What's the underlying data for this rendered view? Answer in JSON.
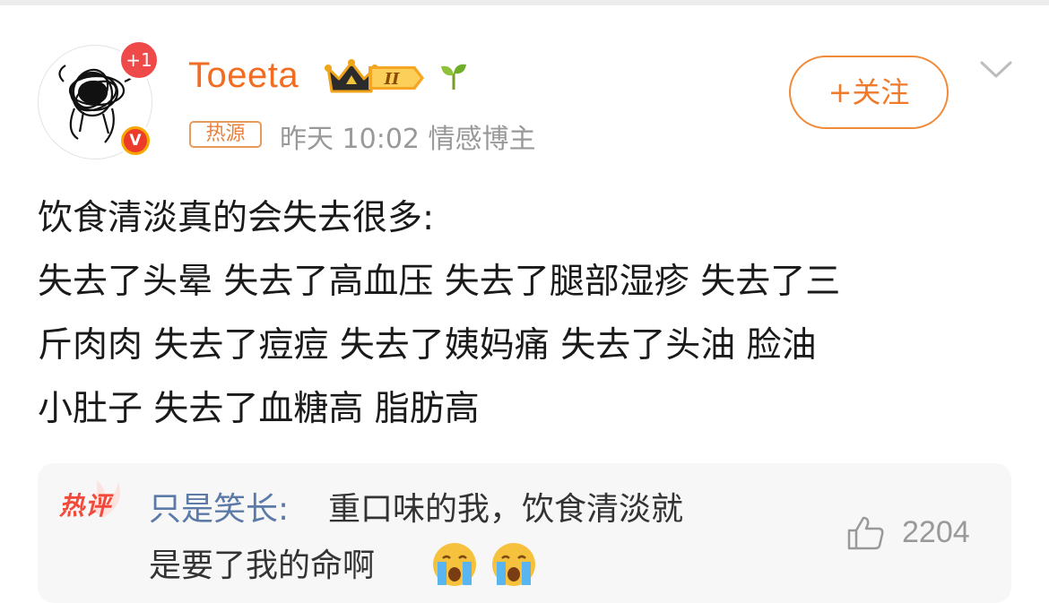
{
  "post": {
    "author": {
      "name": "Toeeta",
      "notification_badge": "+1",
      "verified_badge": "V",
      "level": "II"
    },
    "follow_label": "+关注",
    "source_tag": "热源",
    "meta": "昨天 10:02 情感博主",
    "body_lines": [
      "饮食清淡真的会失去很多:",
      "失去了头晕 失去了高血压 失去了腿部湿疹 失去了三",
      "斤肉肉 失去了痘痘 失去了姨妈痛 失去了头油 脸油",
      "小肚子 失去了血糖高 脂肪高"
    ]
  },
  "hot_comment": {
    "tag": "热评",
    "user": "只是笑长:",
    "line1": "重口味的我，饮食清淡就",
    "line2": "是要了我的命啊",
    "emojis": [
      "crying-emoji",
      "crying-emoji"
    ],
    "likes": "2204"
  },
  "colors": {
    "brand_orange": "#f26d22",
    "link_blue": "#5c7aa8",
    "hot_red": "#f24a3a",
    "meta_gray": "#999999"
  }
}
